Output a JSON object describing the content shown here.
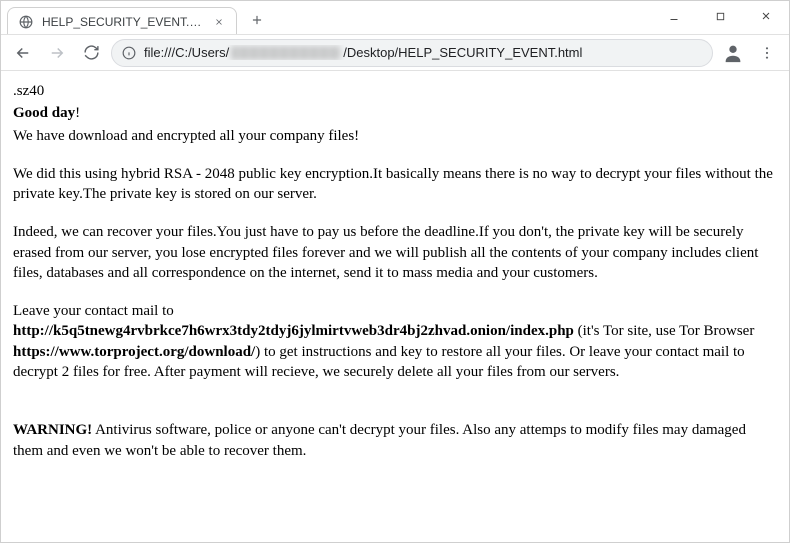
{
  "window": {
    "tab_title": "HELP_SECURITY_EVENT.html",
    "url_prefix": "file:///C:/Users/",
    "url_suffix": "/Desktop/HELP_SECURITY_EVENT.html"
  },
  "doc": {
    "ext_line": ".sz40",
    "greeting": "Good day",
    "greeting_excl": "!",
    "line_encrypted": "We have download and encrypted all your company files!",
    "p_rsa": "We did this using hybrid RSA - 2048 public key encryption.It basically means there is no way to decrypt your files without the private key.The private key is stored on our server.",
    "p_recover": "Indeed, we can recover your files.You just have to pay us before the deadline.If you don't, the private key will be securely erased from our server, you lose encrypted files forever and we will publish all the contents of your company includes client files, databases and all correspondence on the internet, send it to mass media and your customers.",
    "contact_lead": "Leave your contact mail to",
    "onion_url": "http://k5q5tnewg4rvbrkce7h6wrx3tdy2tdyj6jylmirtvweb3dr4bj2zhvad.onion/index.php",
    "contact_mid1": " (it's Tor site, use Tor Browser ",
    "torproject_url": "https://www.torproject.org/download/",
    "contact_mid2": ") to get instructions and key to restore all your files. Or leave your contact mail to decrypt 2 files for free. After payment will recieve, we securely delete all your files from our servers.",
    "warning_label": "WARNING!",
    "warning_text": " Antivirus software, police or anyone can't decrypt your files. Also any attemps to modify files may damaged them and even we won't be able to recover them."
  }
}
